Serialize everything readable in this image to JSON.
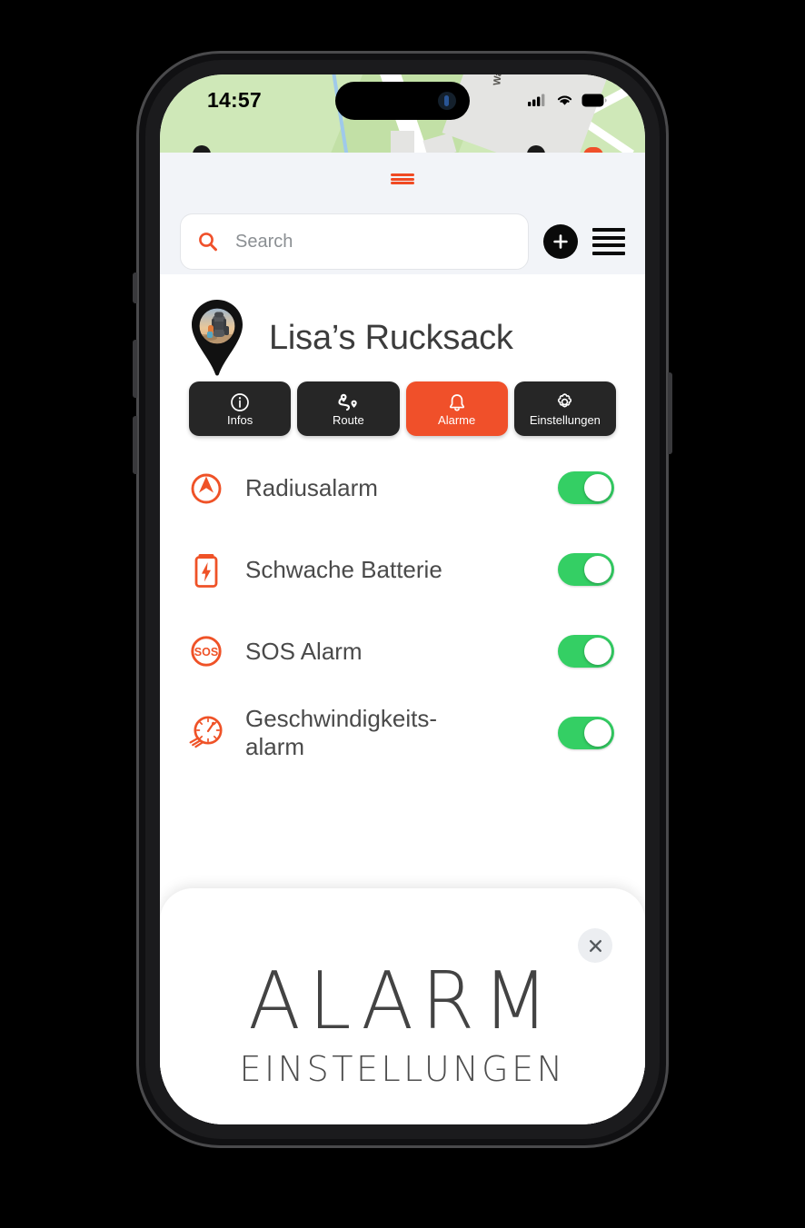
{
  "status_bar": {
    "time": "14:57",
    "cellular_icon": "signal-bars-icon",
    "wifi_icon": "wifi-icon",
    "battery_icon": "battery-icon"
  },
  "map": {
    "street_label": "Wa"
  },
  "header": {
    "drag_handle_icon": "drag-handle-icon",
    "search": {
      "icon": "search-icon",
      "placeholder": "Search",
      "value": ""
    },
    "add_button_icon": "plus-icon",
    "menu_button_icon": "hamburger-menu-icon"
  },
  "profile": {
    "name": "Lisa’s Rucksack",
    "avatar_icon": "map-pin-avatar"
  },
  "actions": [
    {
      "label": "Infos",
      "icon": "info-circle-icon",
      "active": false
    },
    {
      "label": "Route",
      "icon": "route-icon",
      "active": false
    },
    {
      "label": "Alarme",
      "icon": "bell-icon",
      "active": true
    },
    {
      "label": "Einstellungen",
      "icon": "gear-icon",
      "active": false
    }
  ],
  "alarms": [
    {
      "label": "Radiusalarm",
      "icon": "radius-alarm-icon",
      "enabled": true
    },
    {
      "label": "Schwache Batterie",
      "icon": "low-battery-icon",
      "enabled": true
    },
    {
      "label": "SOS Alarm",
      "icon": "sos-icon",
      "enabled": true
    },
    {
      "label": "Geschwindigkeits-\nalarm",
      "icon": "speedometer-icon",
      "enabled": true
    }
  ],
  "bottom_sheet": {
    "title": "ALARM",
    "subtitle": "EINSTELLUNGEN",
    "close_icon": "close-icon"
  },
  "colors": {
    "accent_orange": "#f0502a",
    "toggle_green": "#34cf64",
    "button_dark": "#262626",
    "map_green": "#cfe8b8"
  }
}
